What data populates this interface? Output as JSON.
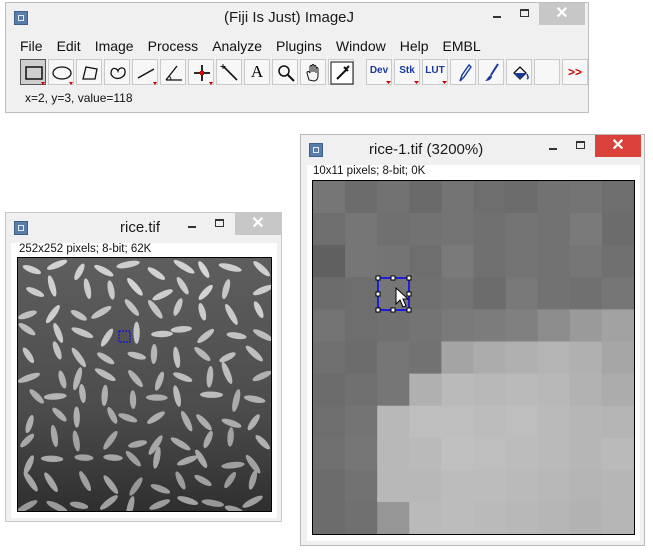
{
  "imagej": {
    "title": "(Fiji Is Just) ImageJ",
    "menus": [
      "File",
      "Edit",
      "Image",
      "Process",
      "Analyze",
      "Plugins",
      "Window",
      "Help",
      "EMBL"
    ],
    "tools": [
      {
        "name": "rectangle-tool-icon",
        "label": ""
      },
      {
        "name": "oval-tool-icon",
        "label": ""
      },
      {
        "name": "polygon-tool-icon",
        "label": ""
      },
      {
        "name": "freehand-tool-icon",
        "label": ""
      },
      {
        "name": "line-tool-icon",
        "label": ""
      },
      {
        "name": "angle-tool-icon",
        "label": ""
      },
      {
        "name": "point-tool-icon",
        "label": ""
      },
      {
        "name": "wand-tool-icon",
        "label": ""
      },
      {
        "name": "text-tool-icon",
        "label": "A"
      },
      {
        "name": "magnifier-tool-icon",
        "label": ""
      },
      {
        "name": "hand-tool-icon",
        "label": ""
      },
      {
        "name": "color-picker-tool-icon",
        "label": ""
      },
      {
        "name": "dev-menu-tool",
        "label": "Dev"
      },
      {
        "name": "stk-menu-tool",
        "label": "Stk"
      },
      {
        "name": "lut-menu-tool",
        "label": "LUT"
      },
      {
        "name": "pencil-tool-icon",
        "label": ""
      },
      {
        "name": "brush-tool-icon",
        "label": ""
      },
      {
        "name": "flood-fill-tool-icon",
        "label": ""
      },
      {
        "name": "empty-tool-slot",
        "label": ""
      },
      {
        "name": "more-tools-icon",
        "label": ">>"
      }
    ],
    "status": "x=2, y=3, value=118"
  },
  "rice_window": {
    "title": "rice.tif",
    "info": "252x252 pixels; 8-bit; 62K"
  },
  "zoom_window": {
    "title": "rice-1.tif (3200%)",
    "info": "10x11 pixels; 8-bit; 0K",
    "pixel_values": [
      [
        118,
        108,
        114,
        106,
        116,
        110,
        108,
        114,
        116,
        110
      ],
      [
        110,
        118,
        112,
        114,
        116,
        112,
        116,
        114,
        122,
        108
      ],
      [
        96,
        118,
        116,
        110,
        122,
        112,
        116,
        114,
        118,
        112
      ],
      [
        108,
        110,
        118,
        112,
        116,
        108,
        120,
        114,
        112,
        118
      ],
      [
        116,
        110,
        112,
        116,
        122,
        124,
        128,
        140,
        154,
        162
      ],
      [
        112,
        108,
        118,
        114,
        164,
        172,
        176,
        180,
        176,
        166
      ],
      [
        108,
        112,
        118,
        176,
        186,
        184,
        186,
        184,
        178,
        172
      ],
      [
        110,
        116,
        184,
        190,
        190,
        188,
        190,
        186,
        182,
        180
      ],
      [
        112,
        118,
        184,
        186,
        192,
        190,
        188,
        186,
        182,
        186
      ],
      [
        108,
        114,
        184,
        184,
        188,
        188,
        186,
        184,
        180,
        182
      ],
      [
        108,
        112,
        150,
        186,
        188,
        186,
        184,
        182,
        178,
        182
      ]
    ]
  }
}
